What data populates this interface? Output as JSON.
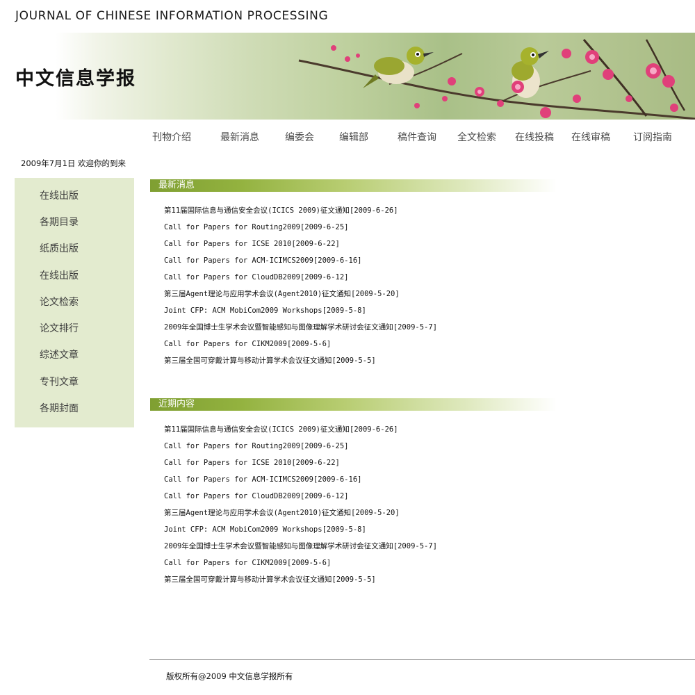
{
  "header": {
    "en_title": "JOURNAL OF CHINESE INFORMATION PROCESSING",
    "cn_title": "中文信息学报"
  },
  "nav": {
    "items": [
      "刊物介绍",
      "最新消息",
      "编委会",
      "编辑部",
      "稿件查询",
      "全文检索",
      "在线投稿",
      "在线审稿",
      "订阅指南"
    ]
  },
  "date_greeting": "2009年7月1日 欢迎你的到来",
  "sidebar": {
    "items": [
      "在线出版",
      "各期目录",
      "纸质出版",
      "在线出版",
      "论文检索",
      "论文排行",
      "综述文章",
      "专刊文章",
      "各期封面"
    ]
  },
  "sections": [
    {
      "title": "最新消息",
      "items": [
        "第11届国际信息与通信安全会议(ICICS 2009)征文通知[2009-6-26]",
        "Call for Papers for Routing2009[2009-6-25]",
        "Call for Papers for ICSE 2010[2009-6-22]",
        "Call for Papers for ACM-ICIMCS2009[2009-6-16]",
        "Call for Papers for CloudDB2009[2009-6-12]",
        "第三届Agent理论与应用学术会议(Agent2010)征文通知[2009-5-20]",
        "Joint CFP: ACM MobiCom2009 Workshops[2009-5-8]",
        "2009年全国博士生学术会议暨智能感知与图像理解学术研讨会征文通知[2009-5-7]",
        "Call for Papers for CIKM2009[2009-5-6]",
        "第三届全国可穿戴计算与移动计算学术会议征文通知[2009-5-5]"
      ]
    },
    {
      "title": "近期内容",
      "items": [
        "第11届国际信息与通信安全会议(ICICS 2009)征文通知[2009-6-26]",
        "Call for Papers for Routing2009[2009-6-25]",
        "Call for Papers for ICSE 2010[2009-6-22]",
        "Call for Papers for ACM-ICIMCS2009[2009-6-16]",
        "Call for Papers for CloudDB2009[2009-6-12]",
        "第三届Agent理论与应用学术会议(Agent2010)征文通知[2009-5-20]",
        "Joint CFP: ACM MobiCom2009 Workshops[2009-5-8]",
        "2009年全国博士生学术会议暨智能感知与图像理解学术研讨会征文通知[2009-5-7]",
        "Call for Papers for CIKM2009[2009-5-6]",
        "第三届全国可穿戴计算与移动计算学术会议征文通知[2009-5-5]"
      ]
    }
  ],
  "footer": {
    "copyright": "版权所有@2009 中文信息学报所有"
  },
  "colors": {
    "sidebar_bg": "#e3ebcf",
    "section_bar": "#8fae3c",
    "banner_green": "#a9c088"
  }
}
